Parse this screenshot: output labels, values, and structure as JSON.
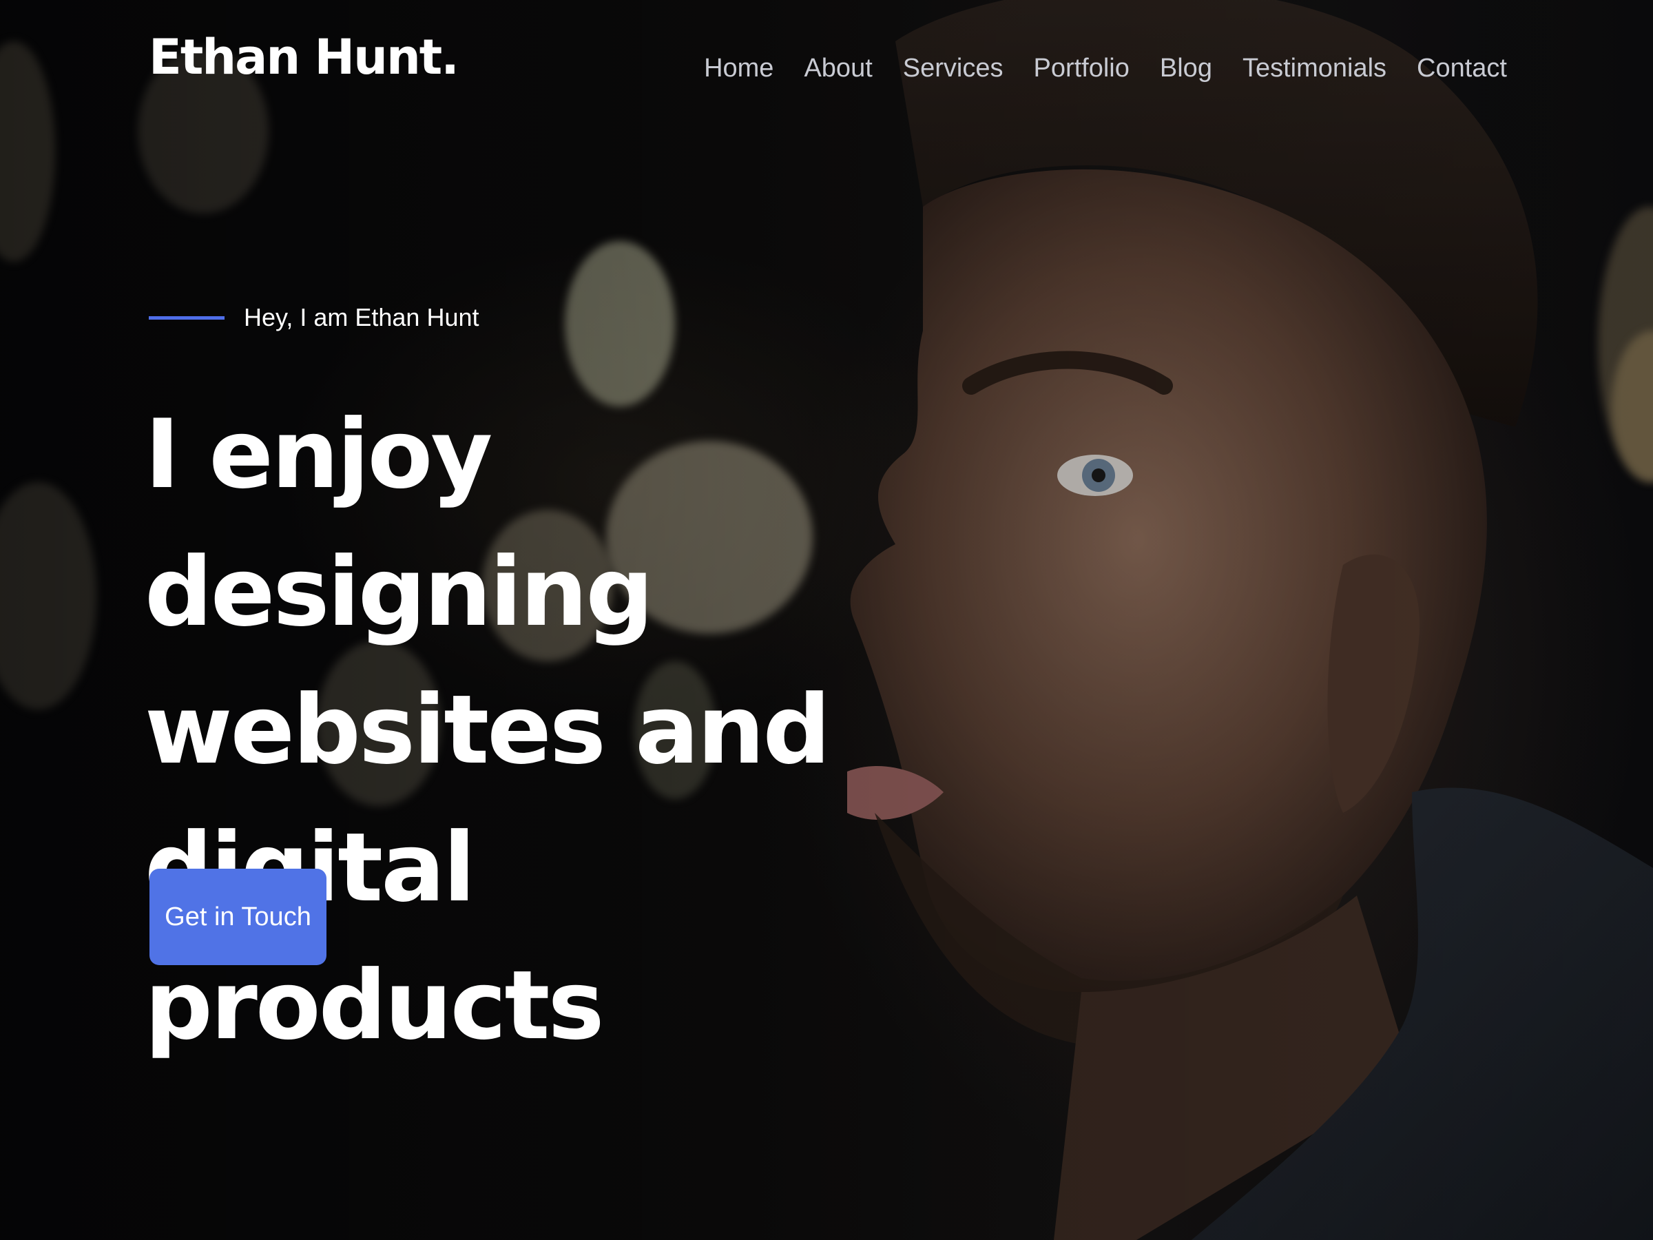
{
  "header": {
    "logo": "Ethan Hunt.",
    "nav": [
      {
        "label": "Home"
      },
      {
        "label": "About"
      },
      {
        "label": "Services"
      },
      {
        "label": "Portfolio"
      },
      {
        "label": "Blog"
      },
      {
        "label": "Testimonials"
      },
      {
        "label": "Contact"
      }
    ]
  },
  "hero": {
    "intro": "Hey, I am Ethan Hunt",
    "headline": "I enjoy designing websites and digital products",
    "cta_label": "Get in Touch",
    "accent_color": "#5073e6"
  }
}
